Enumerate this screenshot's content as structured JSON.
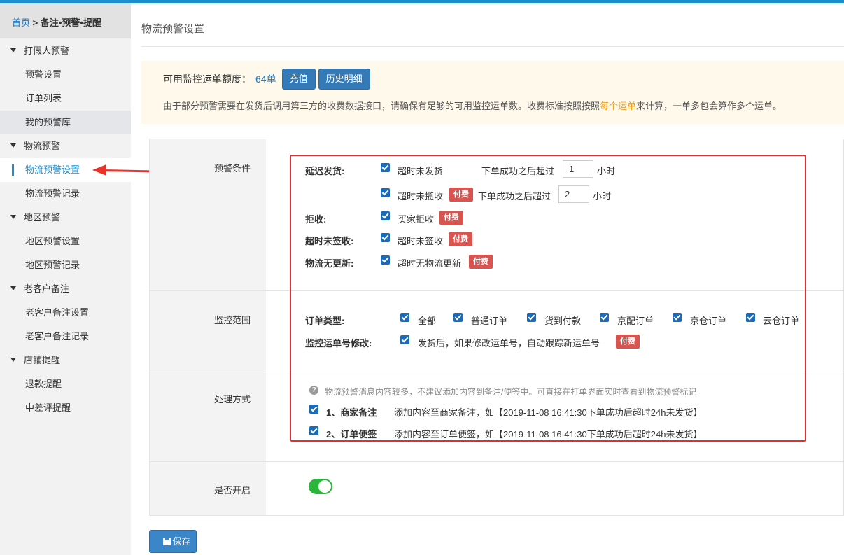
{
  "breadcrumb": {
    "home": "首页",
    "separator": ">",
    "current": "备注•预警•提醒"
  },
  "sidebar": {
    "groups": [
      {
        "label": "打假人预警",
        "items": [
          "预警设置",
          "订单列表",
          "我的预警库"
        ]
      },
      {
        "label": "物流预警",
        "items": [
          "物流预警设置",
          "物流预警记录"
        ]
      },
      {
        "label": "地区预警",
        "items": [
          "地区预警设置",
          "地区预警记录"
        ]
      },
      {
        "label": "老客户备注",
        "items": [
          "老客户备注设置",
          "老客户备注记录"
        ]
      },
      {
        "label": "店铺提醒",
        "items": [
          "退款提醒",
          "中差评提醒"
        ]
      }
    ],
    "active_item": "物流预警设置"
  },
  "page_title": "物流预警设置",
  "quota": {
    "label": "可用监控运单额度：",
    "value": "64单",
    "recharge_button": "充值",
    "history_button": "历史明细",
    "notice_prefix": "由于部分预警需要在发货后调用第三方的收费数据接口，请确保有足够的可用监控运单数。收费标准按照按照",
    "notice_highlight": "每个运单",
    "notice_suffix": "来计算，一单多包会算作多个运单。"
  },
  "sections": {
    "conditions_label": "预警条件",
    "scope_label": "监控范围",
    "handling_label": "处理方式",
    "enable_label": "是否开启"
  },
  "conditions": {
    "delay_label": "延迟发货:",
    "delay_unshipped": "超时未发货",
    "delay_unshipped_prefix": "下单成功之后超过",
    "delay_unshipped_hours": "1",
    "hours_unit": "小时",
    "delay_unpicked": "超时未揽收",
    "delay_unpicked_prefix": "下单成功之后超过",
    "delay_unpicked_hours": "2",
    "reject_label": "拒收:",
    "reject_option": "买家拒收",
    "unsigned_label": "超时未签收:",
    "unsigned_option": "超时未签收",
    "noupdate_label": "物流无更新:",
    "noupdate_option": "超时无物流更新",
    "paid_badge": "付费"
  },
  "scope": {
    "order_type_label": "订单类型:",
    "order_types": [
      "全部",
      "普通订单",
      "货到付款",
      "京配订单",
      "京仓订单",
      "云仓订单"
    ],
    "tracking_label": "监控运单号修改:",
    "tracking_option": "发货后，如果修改运单号，自动跟踪新运单号"
  },
  "handling": {
    "note": "物流预警消息内容较多，不建议添加内容到备注/便签中。可直接在打单界面实时查看到物流预警标记",
    "option1_title": "1、商家备注",
    "option1_desc": "添加内容至商家备注，如【2019-11-08 16:41:30下单成功后超时24h未发货】",
    "option2_title": "2、订单便签",
    "option2_desc": "添加内容至订单便签，如【2019-11-08 16:41:30下单成功后超时24h未发货】"
  },
  "enabled": true,
  "save_button": "保存",
  "colors": {
    "accent": "#1a8fd0",
    "paid": "#d9534f",
    "highlight_box": "#e02f2f",
    "toggle_on": "#2ab53b"
  }
}
